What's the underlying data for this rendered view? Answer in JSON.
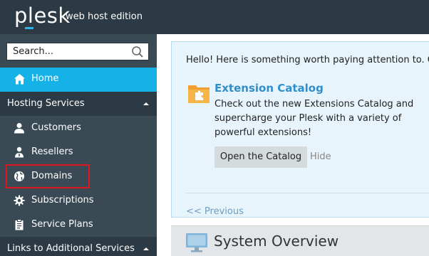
{
  "header": {
    "logo_text": "plesk",
    "edition": "web host edition",
    "bg_color": "#2b3a44",
    "accent_color": "#2fb3e8"
  },
  "sidebar": {
    "search": {
      "placeholder": "Search...",
      "icon": "search-icon"
    },
    "home": {
      "label": "Home",
      "icon": "home-icon",
      "active_color": "#16b1e6"
    },
    "sections": [
      {
        "label": "Hosting Services",
        "state": "expanded",
        "items": [
          {
            "label": "Customers",
            "icon": "user-icon"
          },
          {
            "label": "Resellers",
            "icon": "reseller-icon"
          },
          {
            "label": "Domains",
            "icon": "globe-icon",
            "highlighted": true
          },
          {
            "label": "Subscriptions",
            "icon": "gear-icon"
          },
          {
            "label": "Service Plans",
            "icon": "clipboard-icon"
          }
        ]
      },
      {
        "label": "Links to Additional Services",
        "state": "expanded"
      }
    ],
    "highlight_color": "#e3141c"
  },
  "main": {
    "notice": {
      "hello": "Hello! Here is something worth paying attention to. Chec",
      "title": "Extension Catalog",
      "description": "Check out the new Extensions Catalog and supercharge your Plesk with a variety of powerful extensions!",
      "open_button": "Open the Catalog",
      "hide_link": "Hide",
      "previous_link": "<< Previous",
      "icon": "extension-folder-icon"
    },
    "overview": {
      "title": "System Overview",
      "icon": "monitor-icon"
    }
  }
}
